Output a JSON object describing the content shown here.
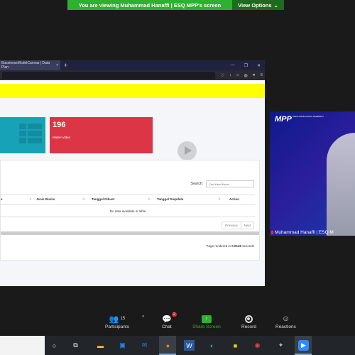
{
  "banner": {
    "text": "You are viewing Muhammad Hanaffi | ESQ MPP's screen",
    "view_options": "View Options"
  },
  "browser": {
    "tab_title": "BussinessModelCanvas | Data Plan",
    "new_tab": "+"
  },
  "cards": [
    {
      "value": "",
      "label": "",
      "color": "#17a2b8"
    },
    {
      "value": "196",
      "label": "Materi Video",
      "color": "#dc3545"
    }
  ],
  "table": {
    "search_label": "Search:",
    "search_placeholder": "Cari Kata Bisnis...",
    "columns": [
      "s",
      "Jenis Bisnis",
      "Tanggal Dibuat",
      "Tanggal Diupdate",
      "Action"
    ],
    "empty_text": "No data available in table",
    "pagination": {
      "previous": "Previous",
      "next": "Next"
    },
    "render_prefix": "Page rendered in ",
    "render_time": "0.0145",
    "render_suffix": " seconds"
  },
  "video": {
    "logo": "MPP",
    "logo_sub": "MADA PENGUSAHA PEMIMPIN",
    "name": "Muhammad Hanaffi | ESQ M"
  },
  "toolbar": {
    "participants_count": "15",
    "participants": "Participants",
    "chat": "Chat",
    "chat_badge": "2",
    "share": "Share Screen",
    "record": "Record",
    "reactions": "Reactions"
  },
  "colors": {
    "share_green": "#2eb12e",
    "yellow": "#ffff00",
    "teal": "#17a2b8",
    "red": "#dc3545"
  }
}
